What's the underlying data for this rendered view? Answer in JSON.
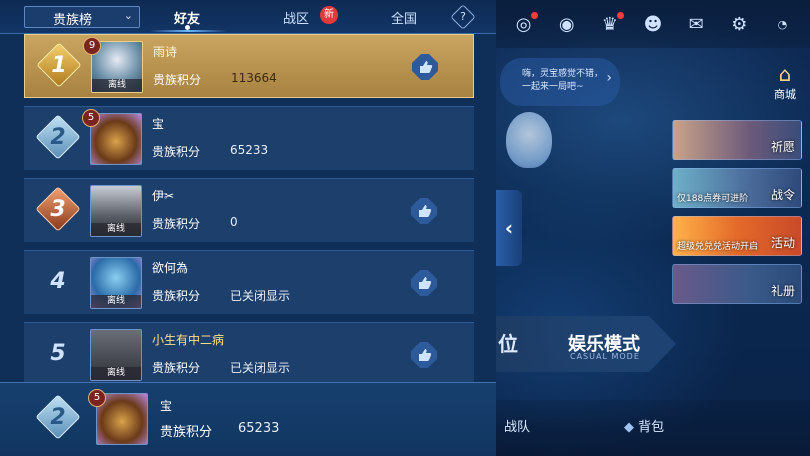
{
  "header": {
    "dropdown_label": "贵族榜",
    "tabs": [
      {
        "label": "好友",
        "active": true
      },
      {
        "label": "战区",
        "badge": "新"
      },
      {
        "label": "全国"
      }
    ],
    "help": "?"
  },
  "score_label": "贵族积分",
  "offline_label": "离线",
  "rows": [
    {
      "rank": "1",
      "name": "雨诗",
      "score": "113664",
      "level": "9",
      "offline": true,
      "highlight": true
    },
    {
      "rank": "2",
      "name": "宝",
      "score": "65233",
      "level": "5",
      "offline": false
    },
    {
      "rank": "3",
      "name": "伊✂",
      "score": "0",
      "offline": true
    },
    {
      "rank": "4",
      "name": "欲何為",
      "score": "已关闭显示",
      "offline": true
    },
    {
      "rank": "5",
      "name": "小生有中二病",
      "score": "已关闭显示",
      "offline": true
    }
  ],
  "self": {
    "rank": "2",
    "name": "宝",
    "score": "65233",
    "level": "5"
  },
  "background": {
    "bubble_text": "嗨，灵宝感觉不错，一起来一局吧~",
    "shop_label": "商城",
    "panels": [
      {
        "label": "祈愿",
        "sub": ""
      },
      {
        "label": "战令",
        "sub": "仅188点券可进阶"
      },
      {
        "label": "活动",
        "sub": "超级兑兑兑活动开启"
      },
      {
        "label": "礼册",
        "sub": ""
      }
    ],
    "mode_left": "位",
    "mode_right": "娱乐模式",
    "mode_right_sub": "CASUAL MODE",
    "bottom_items": [
      "战队",
      "背包"
    ]
  },
  "colors": {
    "gold_row": "#c9a560",
    "row": "#1d3f6b",
    "rank1": "#d9a13a",
    "rank2": "#7fb3d8",
    "rank3": "#c86a3a"
  }
}
